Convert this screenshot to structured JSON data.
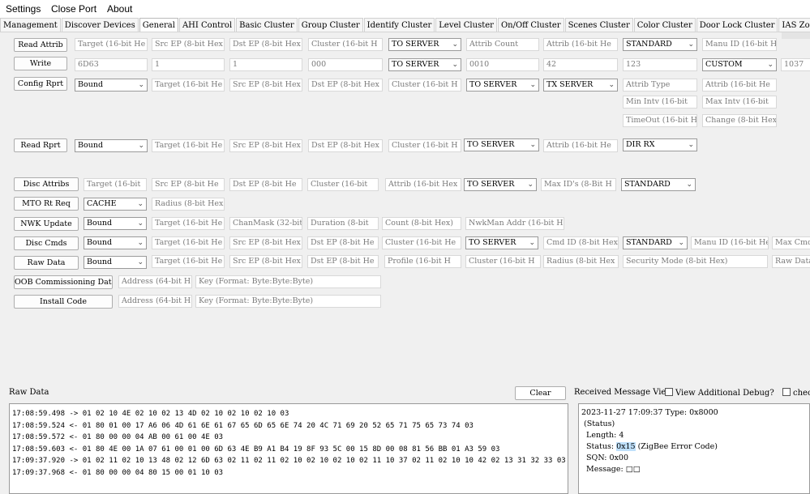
{
  "menu": {
    "settings": "Settings",
    "close_port": "Close Port",
    "about": "About"
  },
  "tabs": [
    "Management",
    "Discover Devices",
    "General",
    "AHI Control",
    "Basic Cluster",
    "Group Cluster",
    "Identify Cluster",
    "Level Cluster",
    "On/Off Cluster",
    "Scenes Cluster",
    "Color Cluster",
    "Door Lock Cluster",
    "IAS Zone Cl"
  ],
  "active_tab": "General",
  "buttons": {
    "read_attrib": "Read Attrib",
    "write": "Write",
    "config_rprt": "Config Rprt",
    "read_rprt": "Read Rprt",
    "disc_attribs": "Disc Attribs",
    "mto_rt_req": "MTO Rt Req",
    "nwk_update": "NWK Update",
    "disc_cmds": "Disc Cmds",
    "raw_data": "Raw Data",
    "oob": "OOB Commissioning Data",
    "install_code": "Install Code",
    "clear": "Clear"
  },
  "read_attrib": {
    "target": "Target (16-bit He",
    "src_ep": "Src EP (8-bit Hex",
    "dst_ep": "Dst EP (8-bit Hex",
    "cluster": "Cluster (16-bit H",
    "direction": "TO SERVER",
    "attrib_count": "Attrib Count",
    "attrib": "Attrib (16-bit He",
    "mode": "STANDARD",
    "manu_id": "Manu ID (16-bit H"
  },
  "write": {
    "target": "6D63",
    "src_ep": "1",
    "dst_ep": "1",
    "cluster": "000",
    "direction": "TO SERVER",
    "attrib": "0010",
    "value": "42",
    "manu": "123",
    "mode": "CUSTOM",
    "extra": "1037"
  },
  "config_rprt": {
    "addr_mode": "Bound",
    "target": "Target (16-bit He",
    "src_ep": "Src EP (8-bit Hex",
    "dst_ep": "Dst EP (8-bit Hex",
    "cluster": "Cluster (16-bit H",
    "direction": "TO SERVER",
    "tx": "TX SERVER",
    "attrib_type": "Attrib Type",
    "attrib": "Attrib (16-bit He",
    "min_intv": "Min Intv (16-bit",
    "max_intv": "Max Intv (16-bit",
    "timeout": "TimeOut (16-bit H",
    "change": "Change (8-bit Hex"
  },
  "read_rprt": {
    "addr_mode": "Bound",
    "target": "Target (16-bit He",
    "src_ep": "Src EP (8-bit Hex",
    "dst_ep": "Dst EP (8-bit Hex",
    "cluster": "Cluster (16-bit H",
    "direction": "TO SERVER",
    "attrib": "Attrib (16-bit He",
    "dir": "DIR RX"
  },
  "disc_attribs": {
    "target": "Target (16-bit",
    "src_ep": "Src EP (8-bit He",
    "dst_ep": "Dst EP (8-bit He",
    "cluster": "Cluster (16-bit",
    "attrib": "Attrib (16-bit Hex",
    "direction": "TO SERVER",
    "max_ids": "Max ID's (8-Bit H",
    "mode": "STANDARD"
  },
  "mto": {
    "mode": "CACHE",
    "radius": "Radius (8-bit Hex"
  },
  "nwk": {
    "addr_mode": "Bound",
    "target": "Target (16-bit He",
    "chanmask": "ChanMask (32-bit",
    "duration": "Duration (8-bit",
    "count": "Count (8-bit Hex)",
    "nwkman": "NwkMan Addr (16-bit He"
  },
  "disc_cmds": {
    "addr_mode": "Bound",
    "target": "Target (16-bit He",
    "src_ep": "Src EP (8-bit Hex",
    "dst_ep": "Dst EP (8-bit He",
    "cluster": "Cluster (16-bit He",
    "direction": "TO SERVER",
    "cmd_id": "Cmd ID (8-bit Hex",
    "mode": "STANDARD",
    "manu_id": "Manu ID (16-bit He",
    "max_cmds": "Max Cmds"
  },
  "raw": {
    "addr_mode": "Bound",
    "target": "Target (16-bit He",
    "src_ep": "Src EP (8-bit Hex",
    "dst_ep": "Dst EP (8-bit He",
    "profile": "Profile (16-bit H",
    "cluster": "Cluster (16-bit H",
    "radius": "Radius (8-bit Hex",
    "security": "Security Mode (8-bit Hex)",
    "raw_data": "Raw Data"
  },
  "oob": {
    "address": "Address (64-bit H",
    "key": "Key (Format: Byte:Byte:Byte)"
  },
  "install": {
    "address": "Address (64-bit H",
    "key": "Key (Format: Byte:Byte:Byte)"
  },
  "bottom": {
    "raw_label": "Raw Data",
    "recv_label": "Received Message View",
    "additional_debug": "View Additional Debug?",
    "check_label": "chec",
    "log_lines": [
      "17:08:59.498 -> 01 02 10 4E 02 10 02 13 4D 02 10 02 10 02 10 03",
      "17:08:59.524 <- 01 80 01 00 17 A6 06 4D 61 6E 61 67 65 6D 65 6E 74 20 4C 71 69 20 52 65 71 75 65 73 74 03",
      "17:08:59.572 <- 01 80 00 00 04 AB 00 61 00 4E 03",
      "17:08:59.603 <- 01 80 4E 00 1A 07 61 00 01 00 6D 63 4E B9 A1 B4 19 8F 93 5C 00 15 8D 00 08 81 56 BB 01 A3 59 03",
      "17:09:37.920 -> 01 02 11 02 10 13 48 02 12 6D 63 02 11 02 11 02 10 02 10 02 10 02 11 10 37 02 11 02 10 10 42 02 13 31 32 33 03",
      "17:09:37.968 <- 01 80 00 00 04 80 15 00 01 10 03"
    ],
    "msg": {
      "line1": "2023-11-27 17:09:37 Type: 0x8000",
      "line2": " (Status)",
      "line3": "  Length: 4",
      "status_prefix": "  Status: ",
      "status_code": "0x15",
      "status_suffix": " (ZigBee Error Code)",
      "line5": "  SQN: 0x00",
      "line6": "  Message: □□"
    }
  }
}
